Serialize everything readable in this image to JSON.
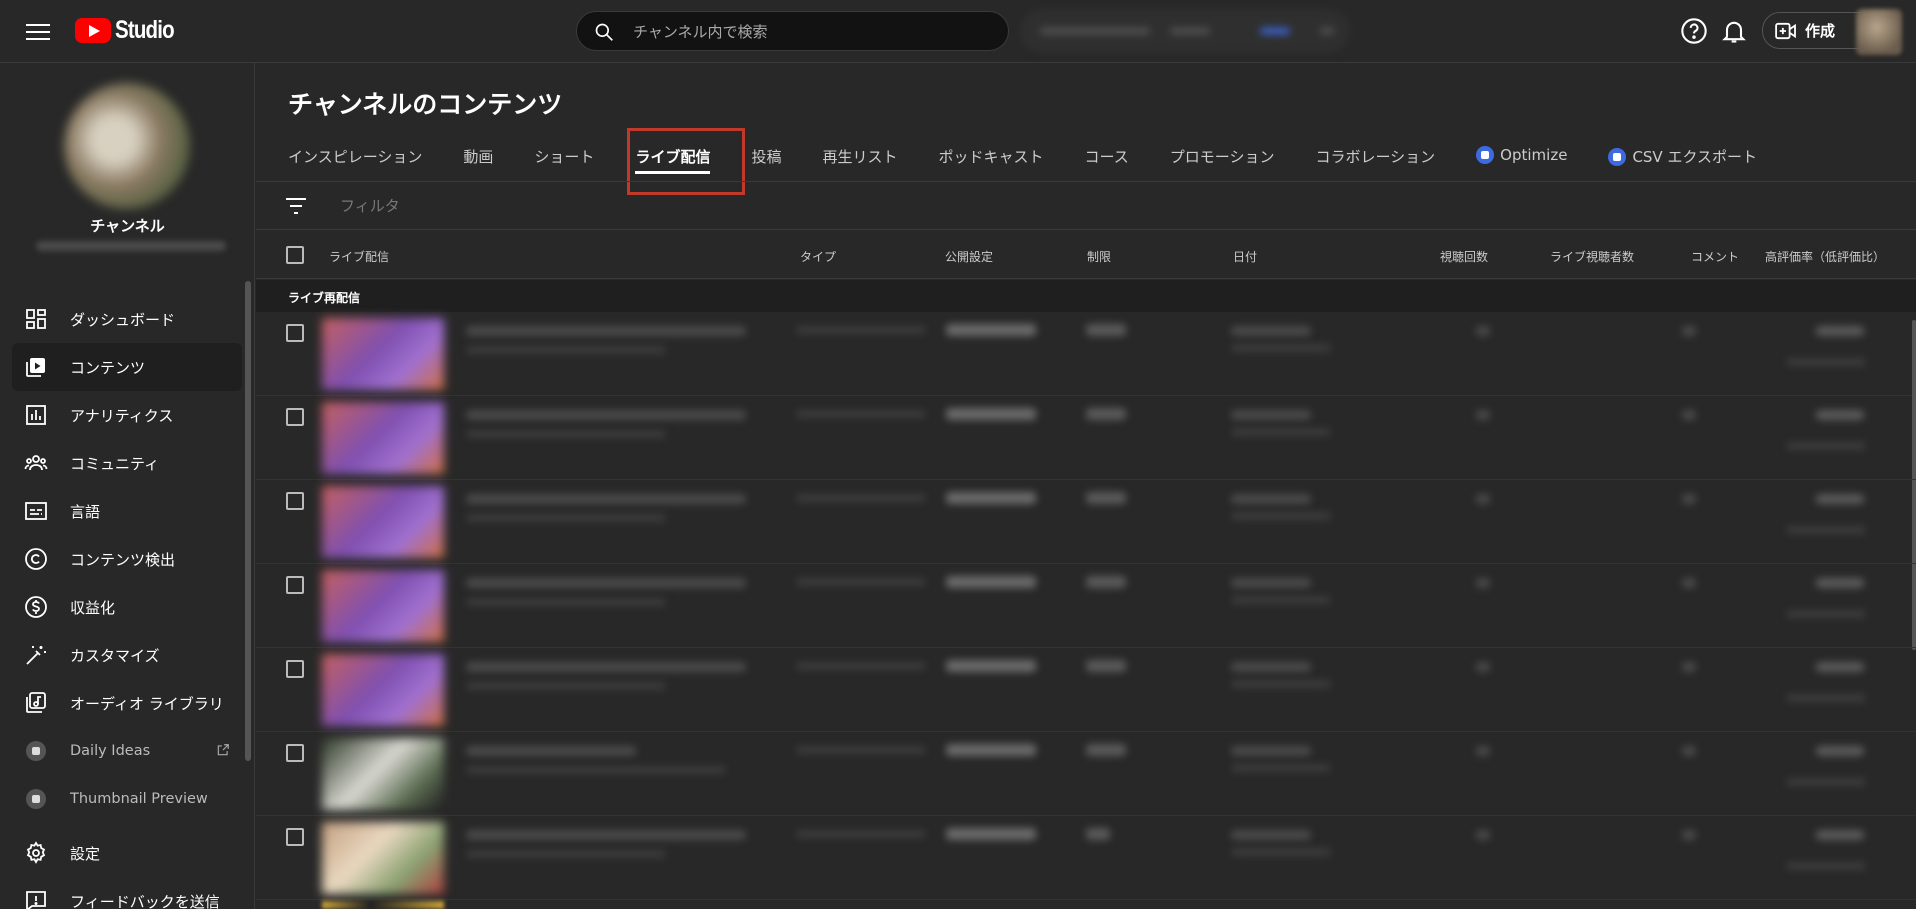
{
  "topbar": {
    "logo_text": "Studio",
    "search_placeholder": "チャンネル内で検索",
    "create_label": "作成"
  },
  "sidebar": {
    "channel_name": "チャンネル",
    "items": [
      {
        "label": "ダッシュボード",
        "icon": "dashboard-icon"
      },
      {
        "label": "コンテンツ",
        "icon": "content-icon",
        "active": true
      },
      {
        "label": "アナリティクス",
        "icon": "analytics-icon"
      },
      {
        "label": "コミュニティ",
        "icon": "community-icon"
      },
      {
        "label": "言語",
        "icon": "subtitles-icon"
      },
      {
        "label": "コンテンツ検出",
        "icon": "copyright-icon"
      },
      {
        "label": "収益化",
        "icon": "dollar-icon"
      },
      {
        "label": "カスタマイズ",
        "icon": "magic-wand-icon"
      },
      {
        "label": "オーディオ ライブラリ",
        "icon": "audio-library-icon"
      },
      {
        "label": "Daily Ideas",
        "icon": "extension-icon",
        "external": true
      },
      {
        "label": "Thumbnail Preview",
        "icon": "extension-icon"
      }
    ],
    "bottom_items": [
      {
        "label": "設定",
        "icon": "gear-icon"
      },
      {
        "label": "フィードバックを送信",
        "icon": "feedback-icon"
      }
    ]
  },
  "main": {
    "title": "チャンネルのコンテンツ",
    "tabs": [
      {
        "label": "インスピレーション"
      },
      {
        "label": "動画"
      },
      {
        "label": "ショート"
      },
      {
        "label": "ライブ配信",
        "active": true
      },
      {
        "label": "投稿"
      },
      {
        "label": "再生リスト"
      },
      {
        "label": "ポッドキャスト"
      },
      {
        "label": "コース"
      },
      {
        "label": "プロモーション"
      },
      {
        "label": "コラボレーション"
      },
      {
        "label": "Optimize",
        "badge": true
      },
      {
        "label": "CSV エクスポート",
        "badge": true
      }
    ],
    "filter_placeholder": "フィルタ",
    "columns": {
      "live": "ライブ配信",
      "type": "タイプ",
      "visibility": "公開設定",
      "restrictions": "制限",
      "date": "日付",
      "views": "視聴回数",
      "live_viewers": "ライブ視聴者数",
      "comments": "コメント",
      "likes": "高評価率（低評価比）"
    },
    "section_label": "ライブ再配信"
  },
  "colors": {
    "background": "#282828",
    "accent_red": "#ff0000",
    "highlight_box": "#c0392b",
    "extension_blue": "#3e6ae1"
  }
}
